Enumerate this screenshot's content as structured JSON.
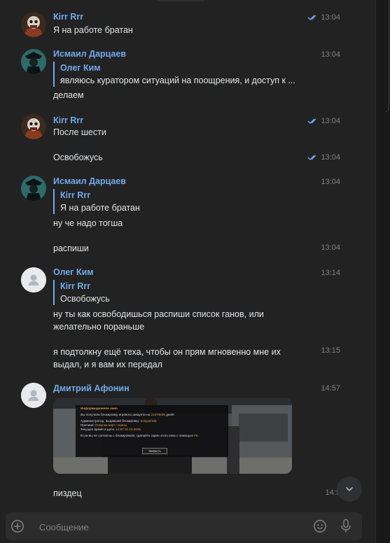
{
  "messages": [
    {
      "name": "Кirr Rrr",
      "time": "13:04",
      "text": "Я на работе братан"
    },
    {
      "name": "Исмаил Дарцаев",
      "time": "13:04",
      "reply_name": "Олег Ким",
      "reply_text": "являюсь куратором ситуаций на поощрения, и доступ к ...",
      "text": "делаем"
    },
    {
      "name": "Кirr Rrr",
      "time": "13:04",
      "text": "После шести"
    },
    {
      "time": "13:04",
      "text": "Освобожусь"
    },
    {
      "name": "Исмаил Дарцаев",
      "time": "13:04",
      "reply_name": "Кirr Rrr",
      "reply_text": "Я на работе братан",
      "text": "ну че надо тогша"
    },
    {
      "time": "13:04",
      "text": "распиши"
    },
    {
      "name": "Олег Ким",
      "time": "13:14",
      "reply_name": "Кirr Rrr",
      "reply_text": "Освобожусь",
      "text_line1": "ну ты как освободишься распиши список ганов, или",
      "text_line2": "желательно пораньше"
    },
    {
      "time": "13:15",
      "text_line1": "я подтолкну ещё теха, чтобы он прям мгновенно мне их",
      "text_line2": "выдал, и я вам их передал"
    },
    {
      "name": "Дмитрий Афонин",
      "time": "14:57"
    },
    {
      "time": "14:5",
      "text": "пиздец"
    }
  ],
  "screenshot": {
    "title": "Информационное окно",
    "line1_a": "Вы получили блокировку игрового аккаунта на",
    "line1_b": "21474836",
    "line1_c": "дней!",
    "line2_a": "Администратор, выдавший блокировку:",
    "line2_b": "kosyachnik",
    "line3_a": "Причина:",
    "line3_b": "Покупка вирт / сканы.",
    "line4_a": "Текущее время и дата:",
    "line4_b": "14:57 02.10.2025.",
    "line5_a": "Если вы не согласны с блокировкой, сделайте скрин этого окна с помощью",
    "line5_b": "F8.",
    "button": "Закрыть"
  },
  "composer": {
    "placeholder": "Сообщение"
  },
  "colors": {
    "accent": "#71aaeb",
    "background": "#222222",
    "time": "#828282"
  }
}
